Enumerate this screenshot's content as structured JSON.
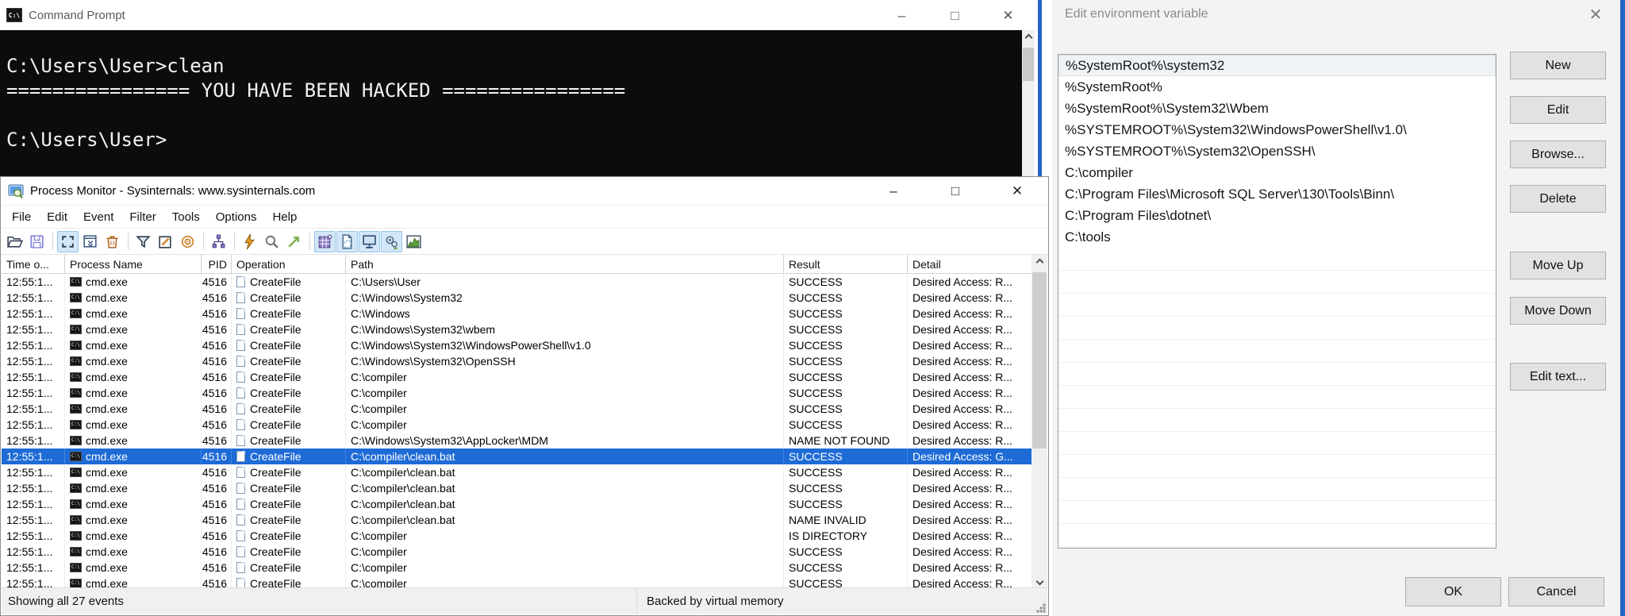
{
  "cmd": {
    "title": "Command Prompt",
    "console_lines": [
      "C:\\Users\\User>clean",
      "================ YOU HAVE BEEN HACKED ================",
      "",
      "C:\\Users\\User>"
    ],
    "caption": {
      "minimize": "–",
      "maximize": "□",
      "close": "✕"
    }
  },
  "procmon": {
    "title": "Process Monitor - Sysinternals: www.sysinternals.com",
    "menu": [
      "File",
      "Edit",
      "Event",
      "Filter",
      "Tools",
      "Options",
      "Help"
    ],
    "toolbar": [
      {
        "name": "open-file-icon",
        "pressed": false
      },
      {
        "name": "save-icon",
        "pressed": false
      },
      {
        "name": "separator"
      },
      {
        "name": "capture-icon",
        "pressed": true
      },
      {
        "name": "autoscroll-icon",
        "pressed": false
      },
      {
        "name": "clear-icon",
        "pressed": false
      },
      {
        "name": "separator"
      },
      {
        "name": "filter-icon",
        "pressed": false
      },
      {
        "name": "highlight-icon",
        "pressed": false
      },
      {
        "name": "include-process-icon",
        "pressed": false
      },
      {
        "name": "separator"
      },
      {
        "name": "process-tree-icon",
        "pressed": false
      },
      {
        "name": "separator"
      },
      {
        "name": "boot-logging-icon",
        "pressed": false
      },
      {
        "name": "find-icon",
        "pressed": false
      },
      {
        "name": "jump-to-icon",
        "pressed": false
      },
      {
        "name": "separator"
      },
      {
        "name": "show-registry-icon",
        "pressed": true
      },
      {
        "name": "show-filesystem-icon",
        "pressed": true
      },
      {
        "name": "show-network-icon",
        "pressed": true
      },
      {
        "name": "show-process-icon",
        "pressed": true
      },
      {
        "name": "show-profiling-icon",
        "pressed": false
      }
    ],
    "columns": [
      "Time o...",
      "Process Name",
      "PID",
      "Operation",
      "Path",
      "Result",
      "Detail"
    ],
    "rows": [
      {
        "time": "12:55:1...",
        "process": "cmd.exe",
        "pid": "4516",
        "op": "CreateFile",
        "path": "C:\\Users\\User",
        "result": "SUCCESS",
        "detail": "Desired Access: R...",
        "selected": false
      },
      {
        "time": "12:55:1...",
        "process": "cmd.exe",
        "pid": "4516",
        "op": "CreateFile",
        "path": "C:\\Windows\\System32",
        "result": "SUCCESS",
        "detail": "Desired Access: R...",
        "selected": false
      },
      {
        "time": "12:55:1...",
        "process": "cmd.exe",
        "pid": "4516",
        "op": "CreateFile",
        "path": "C:\\Windows",
        "result": "SUCCESS",
        "detail": "Desired Access: R...",
        "selected": false
      },
      {
        "time": "12:55:1...",
        "process": "cmd.exe",
        "pid": "4516",
        "op": "CreateFile",
        "path": "C:\\Windows\\System32\\wbem",
        "result": "SUCCESS",
        "detail": "Desired Access: R...",
        "selected": false
      },
      {
        "time": "12:55:1...",
        "process": "cmd.exe",
        "pid": "4516",
        "op": "CreateFile",
        "path": "C:\\Windows\\System32\\WindowsPowerShell\\v1.0",
        "result": "SUCCESS",
        "detail": "Desired Access: R...",
        "selected": false
      },
      {
        "time": "12:55:1...",
        "process": "cmd.exe",
        "pid": "4516",
        "op": "CreateFile",
        "path": "C:\\Windows\\System32\\OpenSSH",
        "result": "SUCCESS",
        "detail": "Desired Access: R...",
        "selected": false
      },
      {
        "time": "12:55:1...",
        "process": "cmd.exe",
        "pid": "4516",
        "op": "CreateFile",
        "path": "C:\\compiler",
        "result": "SUCCESS",
        "detail": "Desired Access: R...",
        "selected": false
      },
      {
        "time": "12:55:1...",
        "process": "cmd.exe",
        "pid": "4516",
        "op": "CreateFile",
        "path": "C:\\compiler",
        "result": "SUCCESS",
        "detail": "Desired Access: R...",
        "selected": false
      },
      {
        "time": "12:55:1...",
        "process": "cmd.exe",
        "pid": "4516",
        "op": "CreateFile",
        "path": "C:\\compiler",
        "result": "SUCCESS",
        "detail": "Desired Access: R...",
        "selected": false
      },
      {
        "time": "12:55:1...",
        "process": "cmd.exe",
        "pid": "4516",
        "op": "CreateFile",
        "path": "C:\\compiler",
        "result": "SUCCESS",
        "detail": "Desired Access: R...",
        "selected": false
      },
      {
        "time": "12:55:1...",
        "process": "cmd.exe",
        "pid": "4516",
        "op": "CreateFile",
        "path": "C:\\Windows\\System32\\AppLocker\\MDM",
        "result": "NAME NOT FOUND",
        "detail": "Desired Access: R...",
        "selected": false
      },
      {
        "time": "12:55:1...",
        "process": "cmd.exe",
        "pid": "4516",
        "op": "CreateFile",
        "path": "C:\\compiler\\clean.bat",
        "result": "SUCCESS",
        "detail": "Desired Access: G...",
        "selected": true
      },
      {
        "time": "12:55:1...",
        "process": "cmd.exe",
        "pid": "4516",
        "op": "CreateFile",
        "path": "C:\\compiler\\clean.bat",
        "result": "SUCCESS",
        "detail": "Desired Access: R...",
        "selected": false
      },
      {
        "time": "12:55:1...",
        "process": "cmd.exe",
        "pid": "4516",
        "op": "CreateFile",
        "path": "C:\\compiler\\clean.bat",
        "result": "SUCCESS",
        "detail": "Desired Access: R...",
        "selected": false
      },
      {
        "time": "12:55:1...",
        "process": "cmd.exe",
        "pid": "4516",
        "op": "CreateFile",
        "path": "C:\\compiler\\clean.bat",
        "result": "SUCCESS",
        "detail": "Desired Access: R...",
        "selected": false
      },
      {
        "time": "12:55:1...",
        "process": "cmd.exe",
        "pid": "4516",
        "op": "CreateFile",
        "path": "C:\\compiler\\clean.bat",
        "result": "NAME INVALID",
        "detail": "Desired Access: R...",
        "selected": false
      },
      {
        "time": "12:55:1...",
        "process": "cmd.exe",
        "pid": "4516",
        "op": "CreateFile",
        "path": "C:\\compiler",
        "result": "IS DIRECTORY",
        "detail": "Desired Access: R...",
        "selected": false
      },
      {
        "time": "12:55:1...",
        "process": "cmd.exe",
        "pid": "4516",
        "op": "CreateFile",
        "path": "C:\\compiler",
        "result": "SUCCESS",
        "detail": "Desired Access: R...",
        "selected": false
      },
      {
        "time": "12:55:1...",
        "process": "cmd.exe",
        "pid": "4516",
        "op": "CreateFile",
        "path": "C:\\compiler",
        "result": "SUCCESS",
        "detail": "Desired Access: R...",
        "selected": false
      },
      {
        "time": "12:55:1...",
        "process": "cmd.exe",
        "pid": "4516",
        "op": "CreateFile",
        "path": "C:\\compiler",
        "result": "SUCCESS",
        "detail": "Desired Access: R...",
        "selected": false
      }
    ],
    "status_left": "Showing all 27 events",
    "status_right": "Backed by virtual memory",
    "caption": {
      "minimize": "–",
      "maximize": "□",
      "close": "✕"
    }
  },
  "dialog": {
    "title": "Edit environment variable",
    "close": "✕",
    "items": [
      "%SystemRoot%\\system32",
      "%SystemRoot%",
      "%SystemRoot%\\System32\\Wbem",
      "%SYSTEMROOT%\\System32\\WindowsPowerShell\\v1.0\\",
      "%SYSTEMROOT%\\System32\\OpenSSH\\",
      "C:\\compiler",
      "C:\\Program Files\\Microsoft SQL Server\\130\\Tools\\Binn\\",
      "C:\\Program Files\\dotnet\\",
      "C:\\tools"
    ],
    "selected_index": 0,
    "side_buttons": [
      "New",
      "Edit",
      "Browse...",
      "Delete",
      "Move Up",
      "Move Down",
      "Edit text..."
    ],
    "ok_label": "OK",
    "cancel_label": "Cancel"
  },
  "colors": {
    "selection_blue": "#1e6bd6",
    "accent_border_blue": "#2563c4",
    "pressed_toolbar_bg": "#d3e7f8",
    "console_bg": "#0c0c0c"
  }
}
